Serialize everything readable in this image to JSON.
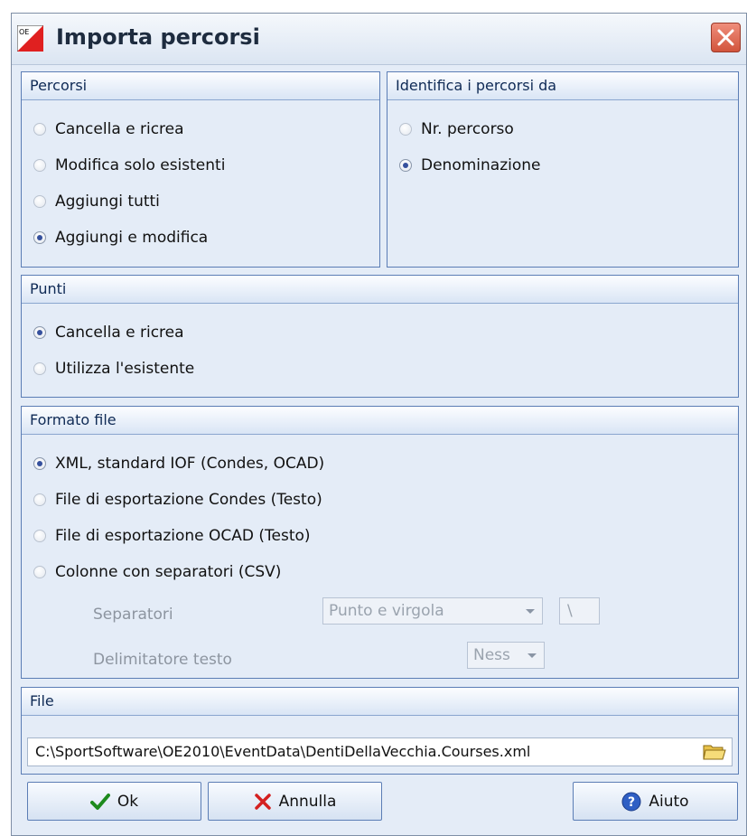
{
  "window": {
    "title": "Importa percorsi",
    "app_icon": "oe-logo-icon",
    "close_icon": "close-icon"
  },
  "percorsi": {
    "header": "Percorsi",
    "options": [
      {
        "label": "Cancella e ricrea",
        "checked": false
      },
      {
        "label": "Modifica solo esistenti",
        "checked": false
      },
      {
        "label": "Aggiungi tutti",
        "checked": false
      },
      {
        "label": "Aggiungi e modifica",
        "checked": true
      }
    ]
  },
  "identifica": {
    "header": "Identifica i percorsi da",
    "options": [
      {
        "label": "Nr. percorso",
        "checked": false
      },
      {
        "label": "Denominazione",
        "checked": true
      }
    ]
  },
  "punti": {
    "header": "Punti",
    "options": [
      {
        "label": "Cancella e ricrea",
        "checked": true
      },
      {
        "label": "Utilizza l'esistente",
        "checked": false
      }
    ]
  },
  "formato": {
    "header": "Formato file",
    "options": [
      {
        "label": "XML, standard IOF (Condes, OCAD)",
        "checked": true
      },
      {
        "label": "File di esportazione Condes (Testo)",
        "checked": false
      },
      {
        "label": "File di esportazione OCAD (Testo)",
        "checked": false
      },
      {
        "label": "Colonne con separatori (CSV)",
        "checked": false
      }
    ],
    "separatori_label": "Separatori",
    "separatori_value": "Punto e virgola",
    "separatori_extra": "\\",
    "delimitatore_label": "Delimitatore testo",
    "delimitatore_value": "Ness"
  },
  "file": {
    "header": "File",
    "path": "C:\\SportSoftware\\OE2010\\EventData\\DentiDellaVecchia.Courses.xml",
    "browse_icon": "folder-open-icon"
  },
  "buttons": {
    "ok": "Ok",
    "annulla": "Annulla",
    "aiuto": "Aiuto"
  },
  "colors": {
    "accent": "#35509d",
    "border": "#5b7db5",
    "background": "#e4ecf7",
    "close": "#d2543c"
  }
}
